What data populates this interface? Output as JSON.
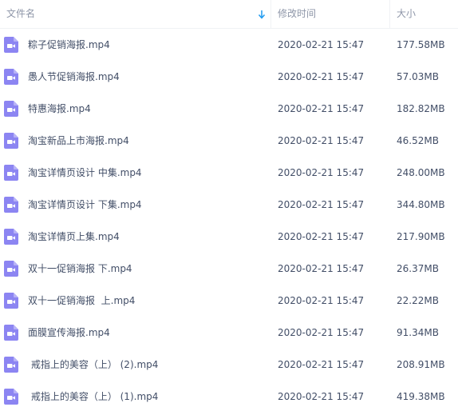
{
  "header": {
    "name_label": "文件名",
    "time_label": "修改时间",
    "size_label": "大小"
  },
  "files": [
    {
      "name": "粽子促销海报.mp4",
      "time": "2020-02-21 15:47",
      "size": "177.58MB"
    },
    {
      "name": "愚人节促销海报.mp4",
      "time": "2020-02-21 15:47",
      "size": "57.03MB"
    },
    {
      "name": "特惠海报.mp4",
      "time": "2020-02-21 15:47",
      "size": "182.82MB"
    },
    {
      "name": "淘宝新品上市海报.mp4",
      "time": "2020-02-21 15:47",
      "size": "46.52MB"
    },
    {
      "name": "淘宝详情页设计 中集.mp4",
      "time": "2020-02-21 15:47",
      "size": "248.00MB"
    },
    {
      "name": "淘宝详情页设计 下集.mp4",
      "time": "2020-02-21 15:47",
      "size": "344.80MB"
    },
    {
      "name": "淘宝详情页上集.mp4",
      "time": "2020-02-21 15:47",
      "size": "217.90MB"
    },
    {
      "name": "双十一促销海报 下.mp4",
      "time": "2020-02-21 15:47",
      "size": "26.37MB"
    },
    {
      "name": "双十一促销海报  上.mp4",
      "time": "2020-02-21 15:47",
      "size": "22.22MB"
    },
    {
      "name": "面膜宣传海报.mp4",
      "time": "2020-02-21 15:47",
      "size": "91.34MB"
    },
    {
      "name": " 戒指上的美容（上） (2).mp4",
      "time": "2020-02-21 15:47",
      "size": "208.91MB"
    },
    {
      "name": " 戒指上的美容（上） (1).mp4",
      "time": "2020-02-21 15:47",
      "size": "419.38MB"
    }
  ],
  "colors": {
    "video_icon": "#8c85f2",
    "sort_arrow": "#1f9bf0",
    "text": "#424e67",
    "header_text": "#8e96a8"
  },
  "icons": {
    "file_icon": "video-file-icon",
    "sort_icon": "sort-down-arrow-icon"
  }
}
